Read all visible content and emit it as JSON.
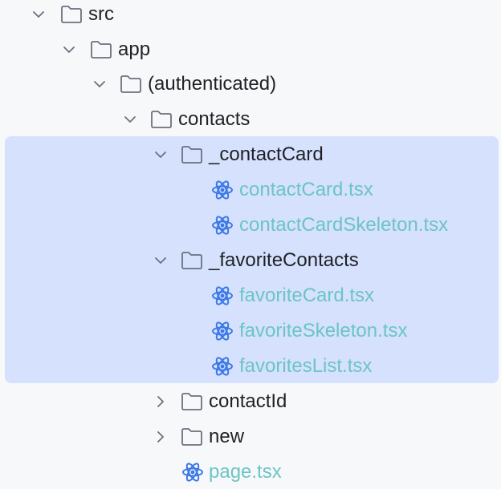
{
  "tree": {
    "items": [
      {
        "label": "src",
        "kind": "folder",
        "expanded": true
      },
      {
        "label": "app",
        "kind": "folder",
        "expanded": true
      },
      {
        "label": "(authenticated)",
        "kind": "folder",
        "expanded": true
      },
      {
        "label": "contacts",
        "kind": "folder",
        "expanded": true
      },
      {
        "label": "_contactCard",
        "kind": "folder",
        "expanded": true,
        "selected": true
      },
      {
        "label": "contactCard.tsx",
        "kind": "react-file",
        "selected": true
      },
      {
        "label": "contactCardSkeleton.tsx",
        "kind": "react-file",
        "selected": true
      },
      {
        "label": "_favoriteContacts",
        "kind": "folder",
        "expanded": true,
        "selected": true
      },
      {
        "label": "favoriteCard.tsx",
        "kind": "react-file",
        "selected": true
      },
      {
        "label": "favoriteSkeleton.tsx",
        "kind": "react-file",
        "selected": true
      },
      {
        "label": "favoritesList.tsx",
        "kind": "react-file",
        "selected": true
      },
      {
        "label": "contactId",
        "kind": "folder",
        "expanded": false
      },
      {
        "label": "new",
        "kind": "folder",
        "expanded": false
      },
      {
        "label": "page.tsx",
        "kind": "react-file"
      }
    ]
  },
  "colors": {
    "background": "#f7f8fa",
    "selection": "#d5e1fd",
    "folder_text": "#1f2126",
    "file_text": "#6cc5c4",
    "react_icon": "#3b78e7",
    "chevron": "#6c707e",
    "folder_icon": "#6c707e"
  },
  "icons": {
    "folder": "folder-icon",
    "react_file": "react-icon",
    "expanded": "chevron-down-icon",
    "collapsed": "chevron-right-icon"
  }
}
